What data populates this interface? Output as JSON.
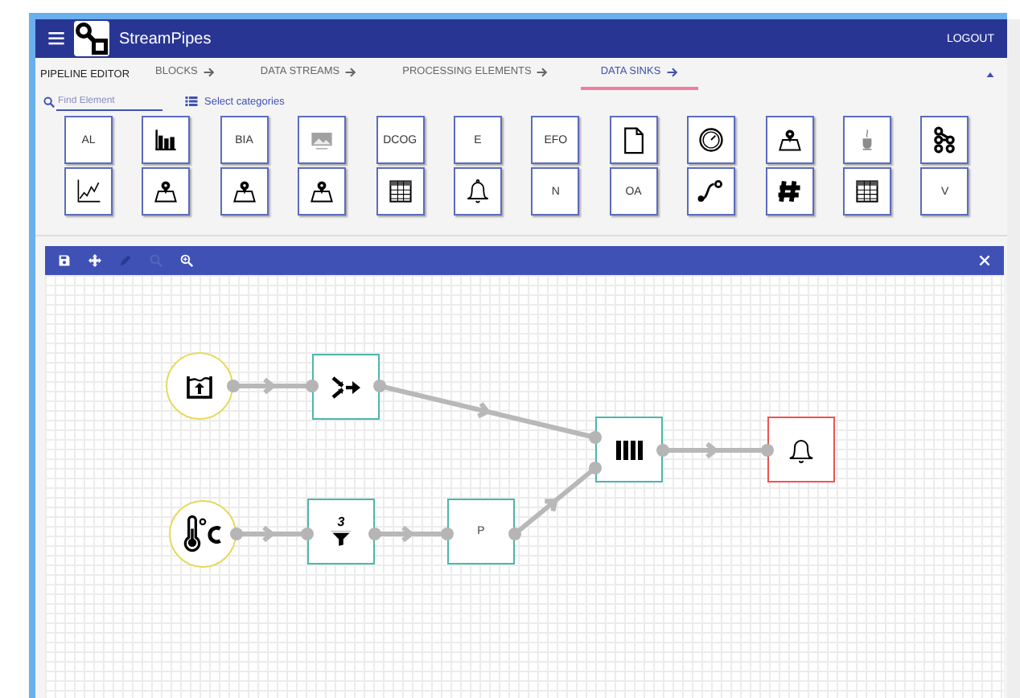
{
  "app": {
    "title": "StreamPipes",
    "logout": "LOGOUT"
  },
  "section_title": "PIPELINE EDITOR",
  "tabs": [
    {
      "label": "BLOCKS",
      "kind": "tab",
      "selected": false
    },
    {
      "label": "DATA STREAMS",
      "kind": "tab",
      "selected": false
    },
    {
      "label": "PROCESSING ELEMENTS",
      "kind": "tab",
      "selected": false
    },
    {
      "label": "DATA SINKS",
      "kind": "tab",
      "selected": true
    }
  ],
  "search": {
    "placeholder": "Find Element"
  },
  "categories_button": "Select categories",
  "palette": [
    {
      "kind": "text",
      "label": "AL"
    },
    {
      "kind": "icon"
    },
    {
      "kind": "text",
      "label": "BIA"
    },
    {
      "kind": "icon"
    },
    {
      "kind": "text",
      "label": "DCOG"
    },
    {
      "kind": "text",
      "label": "E"
    },
    {
      "kind": "text",
      "label": "EFO"
    },
    {
      "kind": "icon"
    },
    {
      "kind": "icon"
    },
    {
      "kind": "icon"
    },
    {
      "kind": "icon"
    },
    {
      "kind": "icon"
    },
    {
      "kind": "icon"
    },
    {
      "kind": "icon"
    },
    {
      "kind": "icon"
    },
    {
      "kind": "icon"
    },
    {
      "kind": "icon"
    },
    {
      "kind": "icon"
    },
    {
      "kind": "text",
      "label": "N"
    },
    {
      "kind": "text",
      "label": "OA"
    },
    {
      "kind": "icon"
    },
    {
      "kind": "icon"
    },
    {
      "kind": "icon"
    },
    {
      "kind": "text",
      "label": "V"
    }
  ],
  "nodes": [
    {
      "kind": "stream"
    },
    {
      "kind": "processor"
    },
    {
      "kind": "stream"
    },
    {
      "kind": "processor",
      "badge": "3"
    },
    {
      "kind": "processor",
      "label": "P"
    },
    {
      "kind": "processor"
    },
    {
      "kind": "sink"
    }
  ]
}
